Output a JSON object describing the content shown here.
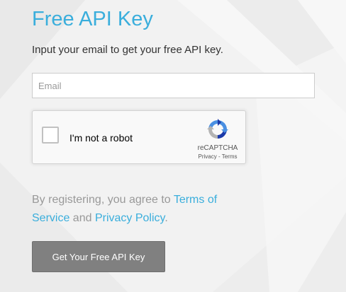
{
  "page": {
    "title": "Free API Key",
    "subtitle": "Input your email to get your free API key."
  },
  "form": {
    "email_placeholder": "Email",
    "email_value": ""
  },
  "captcha": {
    "label": "I'm not a robot",
    "brand": "reCAPTCHA",
    "privacy_link": "Privacy",
    "separator": " - ",
    "terms_link": "Terms"
  },
  "legal": {
    "prefix": "By registering, you agree to ",
    "terms_link": "Terms of Service",
    "conjunction": " and ",
    "privacy_link": "Privacy Policy",
    "suffix": "."
  },
  "submit": {
    "label": "Get Your Free API Key"
  },
  "colors": {
    "accent": "#3aaedc",
    "background": "#f2f2f2",
    "button": "#808080",
    "muted_text": "#999999"
  },
  "icons": {
    "captcha_logo": "recaptcha-logo-icon",
    "checkbox": "checkbox-icon"
  }
}
